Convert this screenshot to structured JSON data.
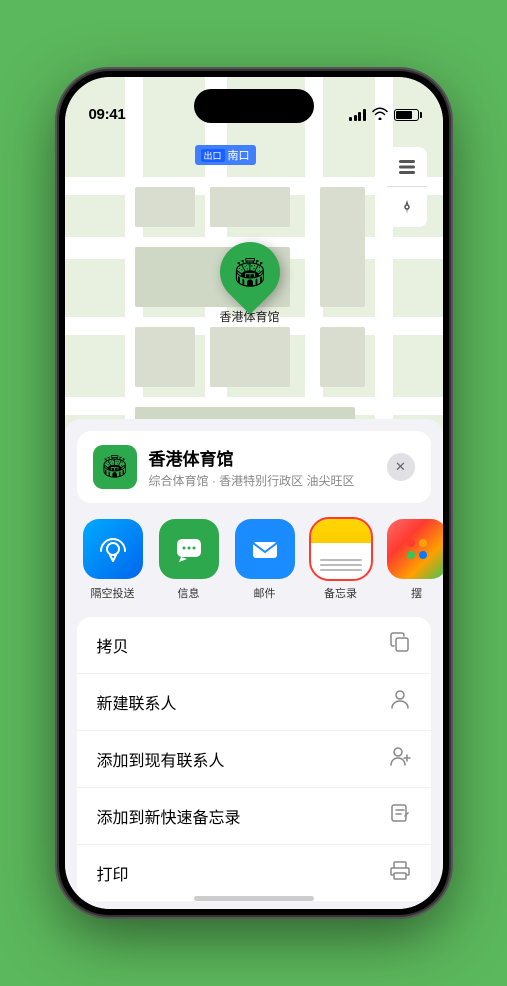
{
  "statusBar": {
    "time": "09:41",
    "location_arrow": "▶"
  },
  "mapControls": {
    "layers_icon": "🗺",
    "compass_icon": "⬆"
  },
  "mapLabel": {
    "badge": "出口",
    "text": "南口"
  },
  "stadiumPin": {
    "name": "香港体育馆"
  },
  "locationCard": {
    "name": "香港体育馆",
    "subtitle": "综合体育馆 · 香港特别行政区 油尖旺区"
  },
  "shareItems": [
    {
      "id": "airdrop",
      "label": "隔空投送",
      "bg": "airdrop"
    },
    {
      "id": "message",
      "label": "信息",
      "bg": "message"
    },
    {
      "id": "mail",
      "label": "邮件",
      "bg": "mail"
    },
    {
      "id": "notes",
      "label": "备忘录",
      "bg": "notes",
      "selected": true
    },
    {
      "id": "more",
      "label": "摆",
      "bg": "more"
    }
  ],
  "actionRows": [
    {
      "label": "拷贝",
      "icon": "copy"
    },
    {
      "label": "新建联系人",
      "icon": "person"
    },
    {
      "label": "添加到现有联系人",
      "icon": "person-add"
    },
    {
      "label": "添加到新快速备忘录",
      "icon": "note"
    },
    {
      "label": "打印",
      "icon": "print"
    }
  ]
}
